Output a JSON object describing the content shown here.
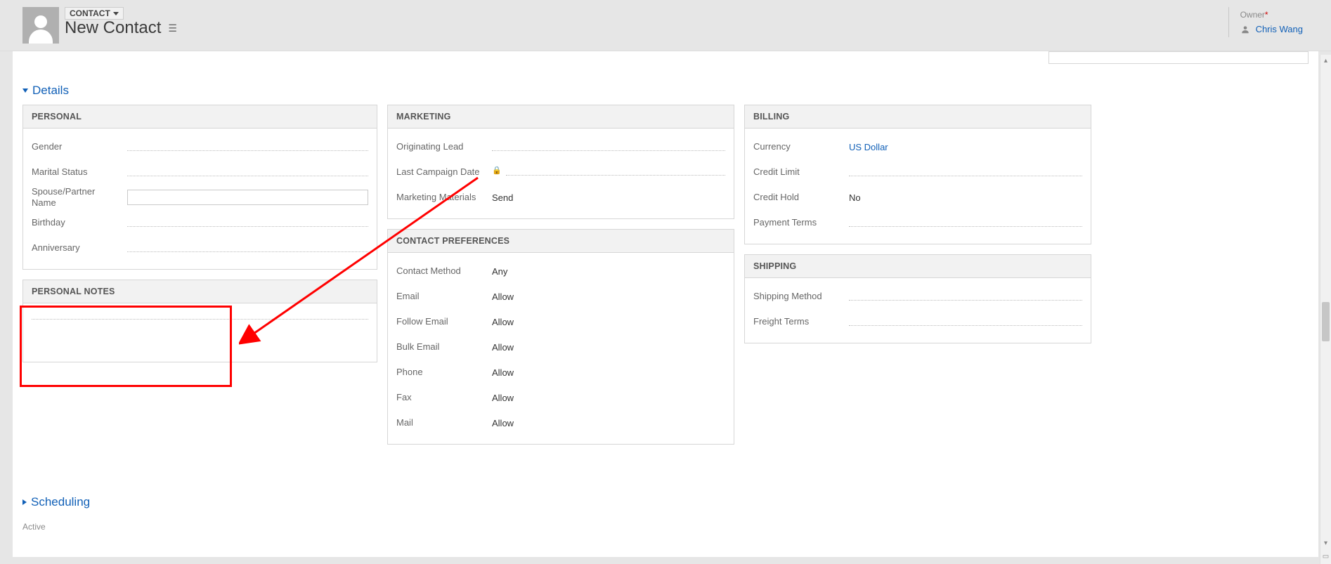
{
  "entity": {
    "type_label": "CONTACT",
    "title": "New Contact"
  },
  "owner": {
    "label": "Owner",
    "name": "Chris Wang"
  },
  "sections": {
    "details_label": "Details",
    "scheduling_label": "Scheduling",
    "active_label": "Active"
  },
  "panels": {
    "personal": {
      "title": "PERSONAL",
      "fields": {
        "gender": {
          "label": "Gender",
          "value": ""
        },
        "marital_status": {
          "label": "Marital Status",
          "value": ""
        },
        "spouse": {
          "label": "Spouse/Partner Name",
          "value": ""
        },
        "birthday": {
          "label": "Birthday",
          "value": ""
        },
        "anniversary": {
          "label": "Anniversary",
          "value": ""
        }
      }
    },
    "personal_notes": {
      "title": "PERSONAL NOTES",
      "value": ""
    },
    "marketing": {
      "title": "MARKETING",
      "fields": {
        "originating_lead": {
          "label": "Originating Lead",
          "value": ""
        },
        "last_campaign": {
          "label": "Last Campaign Date",
          "value": "",
          "locked": true
        },
        "marketing_materials": {
          "label": "Marketing Materials",
          "value": "Send"
        }
      }
    },
    "contact_prefs": {
      "title": "CONTACT PREFERENCES",
      "fields": {
        "contact_method": {
          "label": "Contact Method",
          "value": "Any"
        },
        "email": {
          "label": "Email",
          "value": "Allow"
        },
        "follow_email": {
          "label": "Follow Email",
          "value": "Allow"
        },
        "bulk_email": {
          "label": "Bulk Email",
          "value": "Allow"
        },
        "phone": {
          "label": "Phone",
          "value": "Allow"
        },
        "fax": {
          "label": "Fax",
          "value": "Allow"
        },
        "mail": {
          "label": "Mail",
          "value": "Allow"
        }
      }
    },
    "billing": {
      "title": "BILLING",
      "fields": {
        "currency": {
          "label": "Currency",
          "value": "US Dollar",
          "is_link": true
        },
        "credit_limit": {
          "label": "Credit Limit",
          "value": ""
        },
        "credit_hold": {
          "label": "Credit Hold",
          "value": "No"
        },
        "payment_terms": {
          "label": "Payment Terms",
          "value": ""
        }
      }
    },
    "shipping": {
      "title": "SHIPPING",
      "fields": {
        "shipping_method": {
          "label": "Shipping Method",
          "value": ""
        },
        "freight_terms": {
          "label": "Freight Terms",
          "value": ""
        }
      }
    }
  }
}
